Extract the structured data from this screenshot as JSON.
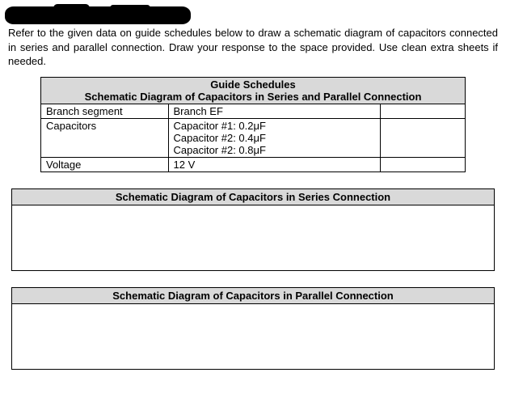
{
  "intro": "Refer to the given data on guide schedules below to draw a schematic diagram of capacitors connected in series and parallel connection. Draw your response to the space provided. Use clean extra sheets if needed.",
  "guide": {
    "title1": "Guide Schedules",
    "title2": "Schematic Diagram of Capacitors in Series and Parallel Connection",
    "rows": {
      "branch_segment": {
        "label": "Branch segment",
        "value": "Branch EF"
      },
      "capacitors": {
        "label": "Capacitors",
        "lines": [
          "Capacitor #1: 0.2μF",
          "Capacitor #2: 0.4μF",
          "Capacitor #2: 0.8μF"
        ]
      },
      "voltage": {
        "label": "Voltage",
        "value": "12 V"
      }
    }
  },
  "section_series": "Schematic Diagram of Capacitors in Series Connection",
  "section_parallel": "Schematic Diagram of Capacitors in Parallel Connection"
}
